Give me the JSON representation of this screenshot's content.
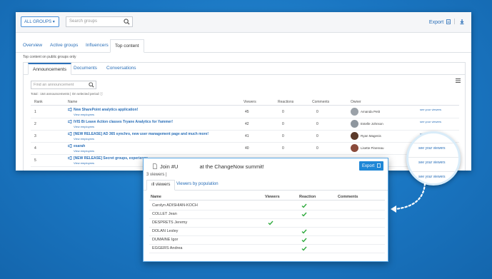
{
  "topbar": {
    "groups_dropdown": "ALL GROUPS ▾",
    "search_placeholder": "Search groups",
    "export_label": "Export"
  },
  "tabs": [
    {
      "label": "Overview"
    },
    {
      "label": "Active groups"
    },
    {
      "label": "Influencers"
    },
    {
      "label": "Top content"
    }
  ],
  "note": "Top content on public groups only",
  "subtabs": [
    {
      "label": "Announcements"
    },
    {
      "label": "Documents"
    },
    {
      "label": "Conversations"
    }
  ],
  "find_placeholder": "Find an announcement",
  "total": "Total : 164 announcements | On selected period ⓘ",
  "table": {
    "headers": {
      "rank": "Rank",
      "name": "Name",
      "viewers": "Viewers",
      "reactions": "Reactions",
      "comments": "Comments",
      "owner": "Owner"
    },
    "rows": [
      {
        "rank": "1",
        "name": "New SharePoint analytics application!",
        "sub": "View employees",
        "viewers": "45",
        "reactions": "0",
        "comments": "0",
        "owner": "Amanda Petit",
        "see": "see your viewers",
        "avatar_color": "#9aa1a8"
      },
      {
        "rank": "2",
        "name": "IVIS Bi Leave Action classes Tryane Analytics for Yammer!",
        "sub": "View employees",
        "viewers": "42",
        "reactions": "0",
        "comments": "0",
        "owner": "Estelle Johnson",
        "see": "see your viewers",
        "avatar_color": "#8e969e"
      },
      {
        "rank": "3",
        "name": "[NEW RELEASE] AD 365 synchro, new user management page and much more!",
        "sub": "View employees",
        "viewers": "41",
        "reactions": "0",
        "comments": "0",
        "owner": "Ryan Magenis",
        "see": "see your viewers",
        "avatar_color": "#5b3a2a"
      },
      {
        "rank": "4",
        "name": "esarah",
        "sub": "View employees",
        "viewers": "40",
        "reactions": "0",
        "comments": "0",
        "owner": "Lisette Pinereau",
        "see": "see your viewers",
        "avatar_color": "#8a4a3a"
      },
      {
        "rank": "5",
        "name": "[NEW RELEASE] Secret groups, experience",
        "sub": "View employees",
        "viewers": "",
        "reactions": "",
        "comments": "",
        "owner": "",
        "see": "",
        "avatar_color": ""
      }
    ]
  },
  "magnifier": {
    "links": [
      "see your viewers",
      "see your viewers",
      "see your viewers"
    ]
  },
  "popup": {
    "title_start": "Join #U",
    "title_end": "at the ChangeNow summit!",
    "viewers_count": "3 viewers |",
    "export_label": "Export",
    "tabs": [
      {
        "label": "ıll viewers"
      },
      {
        "label": "Viewers by population"
      }
    ],
    "headers": {
      "name": "Name",
      "viewers": "Viewers",
      "reaction": "Reaction",
      "comments": "Comments"
    },
    "rows": [
      {
        "name": "Carolyn ADISHIAN-KOCH",
        "viewer": false,
        "reaction": true
      },
      {
        "name": "COLLET Jean",
        "viewer": false,
        "reaction": true
      },
      {
        "name": "DESPRETS Jeremy",
        "viewer": true,
        "reaction": false
      },
      {
        "name": "DOLAN Lesley",
        "viewer": false,
        "reaction": true
      },
      {
        "name": "DUMAINE Igor",
        "viewer": false,
        "reaction": true
      },
      {
        "name": "EGGERS Andrea",
        "viewer": false,
        "reaction": true
      }
    ]
  },
  "colors": {
    "accent": "#2a6fb8",
    "check": "#2eaa3d",
    "background": "#1a76c2"
  }
}
